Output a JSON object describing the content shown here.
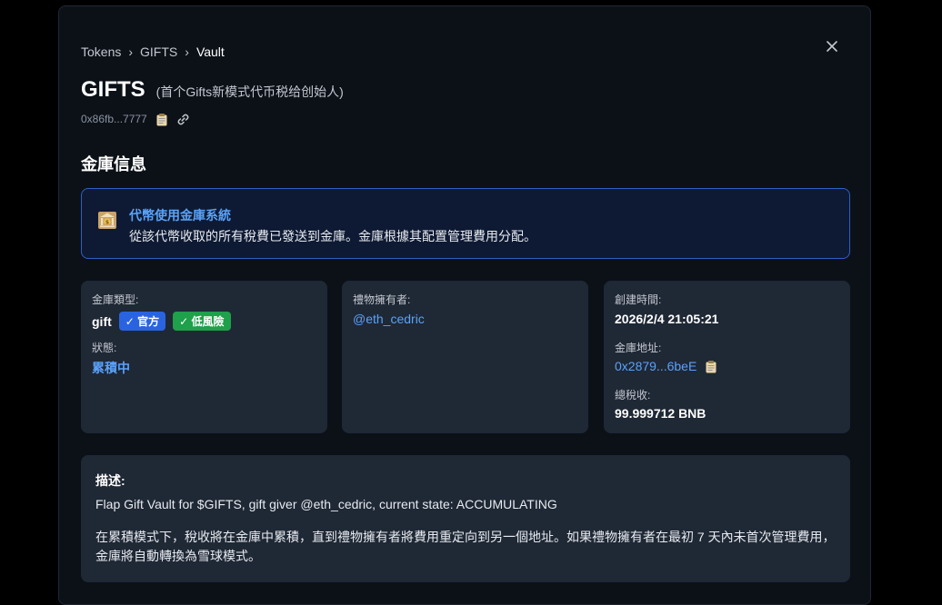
{
  "breadcrumb": {
    "items": [
      "Tokens",
      "GIFTS"
    ],
    "current": "Vault",
    "separator": "›"
  },
  "close_icon": "close-icon",
  "header": {
    "title": "GIFTS",
    "subtitle": "(首个Gifts新模式代币税给创始人)",
    "address": "0x86fb...7777"
  },
  "section_title": "金庫信息",
  "info_box": {
    "title": "代幣使用金庫系統",
    "text": "從該代幣收取的所有稅費已發送到金庫。金庫根據其配置管理費用分配。"
  },
  "card1": {
    "type_label": "金庫類型:",
    "type_value": "gift",
    "badge_official": "✓ 官方",
    "badge_risk": "✓ 低風險",
    "status_label": "狀態:",
    "status_value": "累積中"
  },
  "card2": {
    "owner_label": "禮物擁有者:",
    "owner_value": "@eth_cedric"
  },
  "card3": {
    "created_label": "創建時間:",
    "created_value": "2026/2/4 21:05:21",
    "vault_addr_label": "金庫地址:",
    "vault_addr_value": "0x2879...6beE",
    "total_tax_label": "總稅收:",
    "total_tax_value": "99.999712 BNB"
  },
  "description": {
    "title": "描述:",
    "line1": "Flap Gift Vault for $GIFTS, gift giver @eth_cedric, current state: ACCUMULATING",
    "paragraph": "在累積模式下，稅收將在金庫中累積，直到禮物擁有者將費用重定向到另一個地址。如果禮物擁有者在最初 7 天內未首次管理費用，金庫將自動轉換為雪球模式。"
  },
  "colors": {
    "background": "#000000",
    "modal": "#0c1118",
    "card": "#1f2835",
    "accent": "#5aa2f8",
    "info_border": "#2e5fc5",
    "badge_blue": "#2a63e0",
    "badge_green": "#1fa04a"
  }
}
